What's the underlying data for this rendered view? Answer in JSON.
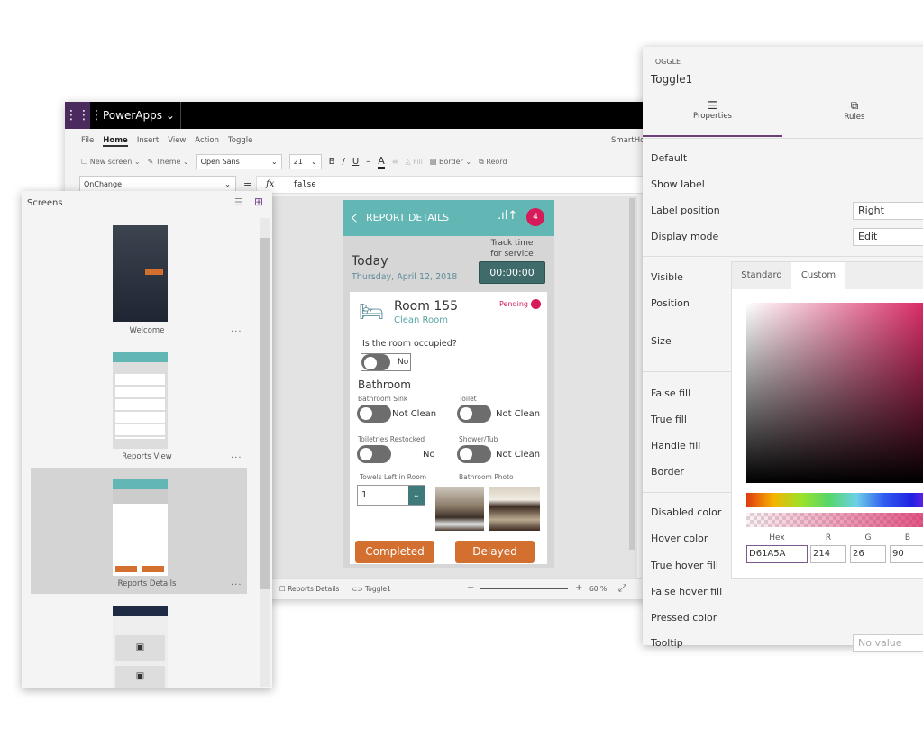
{
  "app": {
    "name": "PowerApps",
    "title": "SmartHo"
  },
  "menu": [
    "File",
    "Home",
    "Insert",
    "View",
    "Action",
    "Toggle"
  ],
  "toolbar": {
    "new_screen": "New screen",
    "theme": "Theme",
    "font": "Open Sans",
    "size": "21",
    "bold": "B",
    "italic": "/",
    "underline": "U",
    "fill": "Fill",
    "border": "Border",
    "reorder": "Reord"
  },
  "formula": {
    "property": "OnChange",
    "equals": "=",
    "fx": "fx",
    "value": "false"
  },
  "screens": {
    "title": "Screens",
    "items": [
      {
        "name": "Welcome"
      },
      {
        "name": "Reports View"
      },
      {
        "name": "Reports Details",
        "selected": true
      },
      {
        "name": ""
      }
    ],
    "more": "..."
  },
  "phone": {
    "header": "REPORT DETAILS",
    "badge": "4",
    "today": "Today",
    "date": "Thursday, April 12, 2018",
    "track": "Track time for service",
    "timer": "00:00:00",
    "room": "Room 155",
    "room_sub": "Clean Room",
    "status": "Pending",
    "question": "Is the room occupied?",
    "occupied": "No",
    "section": "Bathroom",
    "items": [
      {
        "label": "Bathroom Sink",
        "value": "Not Clean"
      },
      {
        "label": "Toilet",
        "value": "Not Clean"
      },
      {
        "label": "Toiletries Restocked",
        "value": "No"
      },
      {
        "label": "Shower/Tub",
        "value": "Not Clean"
      }
    ],
    "towels_label": "Towels Left in Room",
    "towels_value": "1",
    "photo_label": "Bathroom Photo",
    "completed": "Completed",
    "delayed": "Delayed"
  },
  "status": {
    "screen": "Reports Details",
    "control": "Toggle1",
    "zoom": "60",
    "zoom_unit": "%",
    "zoom_minus": "−",
    "zoom_plus": "+"
  },
  "props": {
    "type": "TOGGLE",
    "name": "Toggle1",
    "tabs": [
      "Properties",
      "Rules"
    ],
    "rows": [
      "Default",
      "Show label",
      "Label position",
      "Display mode",
      "Visible",
      "Position",
      "Size",
      "False fill",
      "True fill",
      "Handle fill",
      "Border",
      "Disabled color",
      "Hover color",
      "True hover fill",
      "False hover fill",
      "Pressed color",
      "Tooltip"
    ],
    "label_position": "Right",
    "display_mode": "Edit",
    "tooltip_placeholder": "No value"
  },
  "picker": {
    "tabs": [
      "Standard",
      "Custom"
    ],
    "hex_label": "Hex",
    "r_label": "R",
    "g_label": "G",
    "b_label": "B",
    "hex": "D61A5A",
    "r": "214",
    "g": "26",
    "b": "90"
  },
  "colors": {
    "teal": "#62b7b5",
    "orange": "#d36f2f",
    "pending": "#d61a5a",
    "purple": "#4b2a5e"
  }
}
